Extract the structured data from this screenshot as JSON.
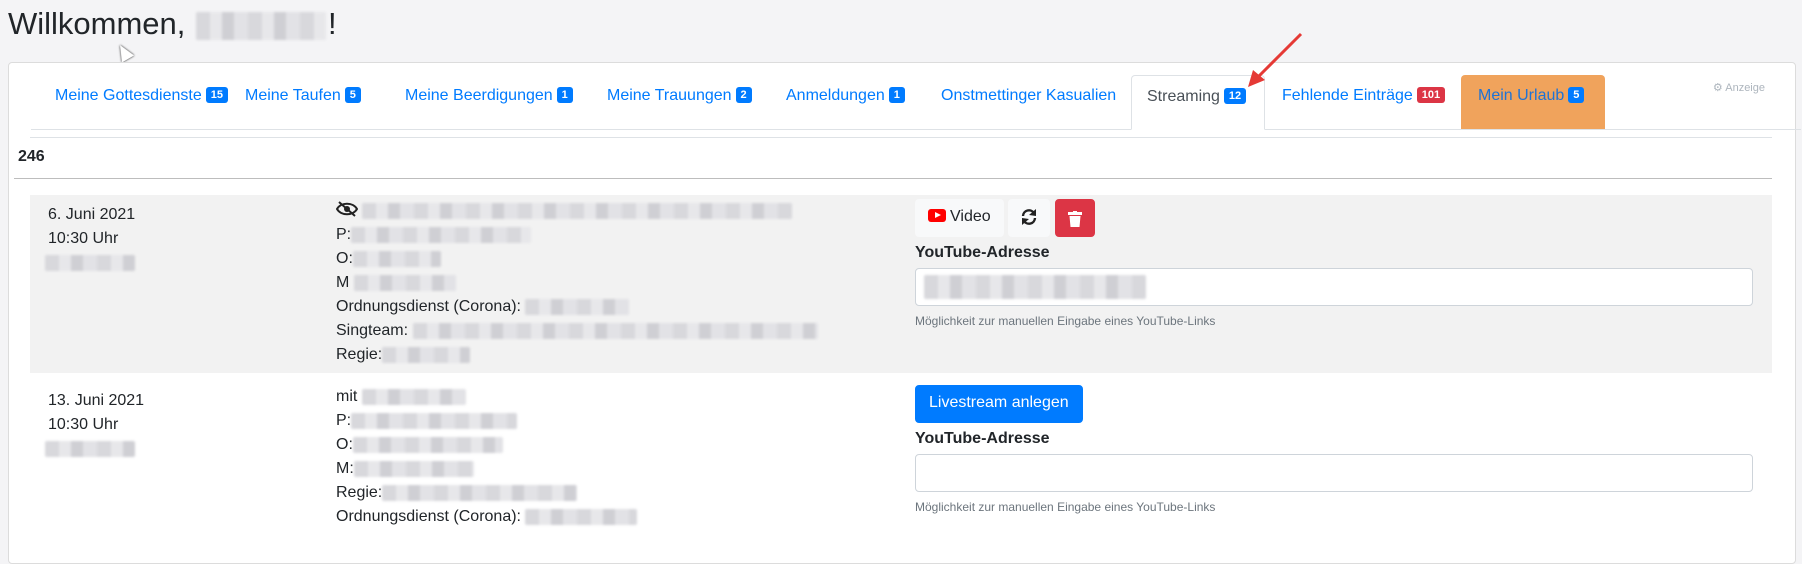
{
  "header": {
    "welcome_prefix": "Willkommen,",
    "welcome_suffix": "!"
  },
  "tabs": [
    {
      "label": "Meine Gottesdienste",
      "badge": "15"
    },
    {
      "label": "Meine Taufen",
      "badge": "5"
    },
    {
      "label": "Meine Beerdigungen",
      "badge": "1"
    },
    {
      "label": "Meine Trauungen",
      "badge": "2"
    },
    {
      "label": "Anmeldungen",
      "badge": "1"
    },
    {
      "label": "Onstmettinger Kasualien",
      "badge": ""
    },
    {
      "label": "Streaming",
      "badge": "12"
    },
    {
      "label": "Fehlende Einträge",
      "badge": "101"
    },
    {
      "label": "Mein Urlaub",
      "badge": "5"
    }
  ],
  "settings_label": "Anzeige",
  "count": "246",
  "entries": [
    {
      "date": "6. Juni 2021",
      "time": "10:30 Uhr",
      "lines": [
        "P:",
        "O:",
        "M",
        "Ordnungsdienst (Corona):",
        "Singteam:",
        "Regie:"
      ],
      "video_button": "Video",
      "field_label": "YouTube-Adresse",
      "hint": "Möglichkeit zur manuellen Eingabe eines YouTube-Links"
    },
    {
      "date": "13. Juni 2021",
      "time": "10:30 Uhr",
      "lines": [
        "mit",
        "P:",
        "O:",
        "M:",
        "Regie:",
        "Ordnungsdienst (Corona):"
      ],
      "create_button": "Livestream anlegen",
      "field_label": "YouTube-Adresse",
      "hint": "Möglichkeit zur manuellen Eingabe eines YouTube-Links"
    }
  ],
  "colors": {
    "primary": "#007bff",
    "danger": "#dc3545",
    "vacation_tab": "#f0a35c",
    "arrow": "#e53935"
  }
}
